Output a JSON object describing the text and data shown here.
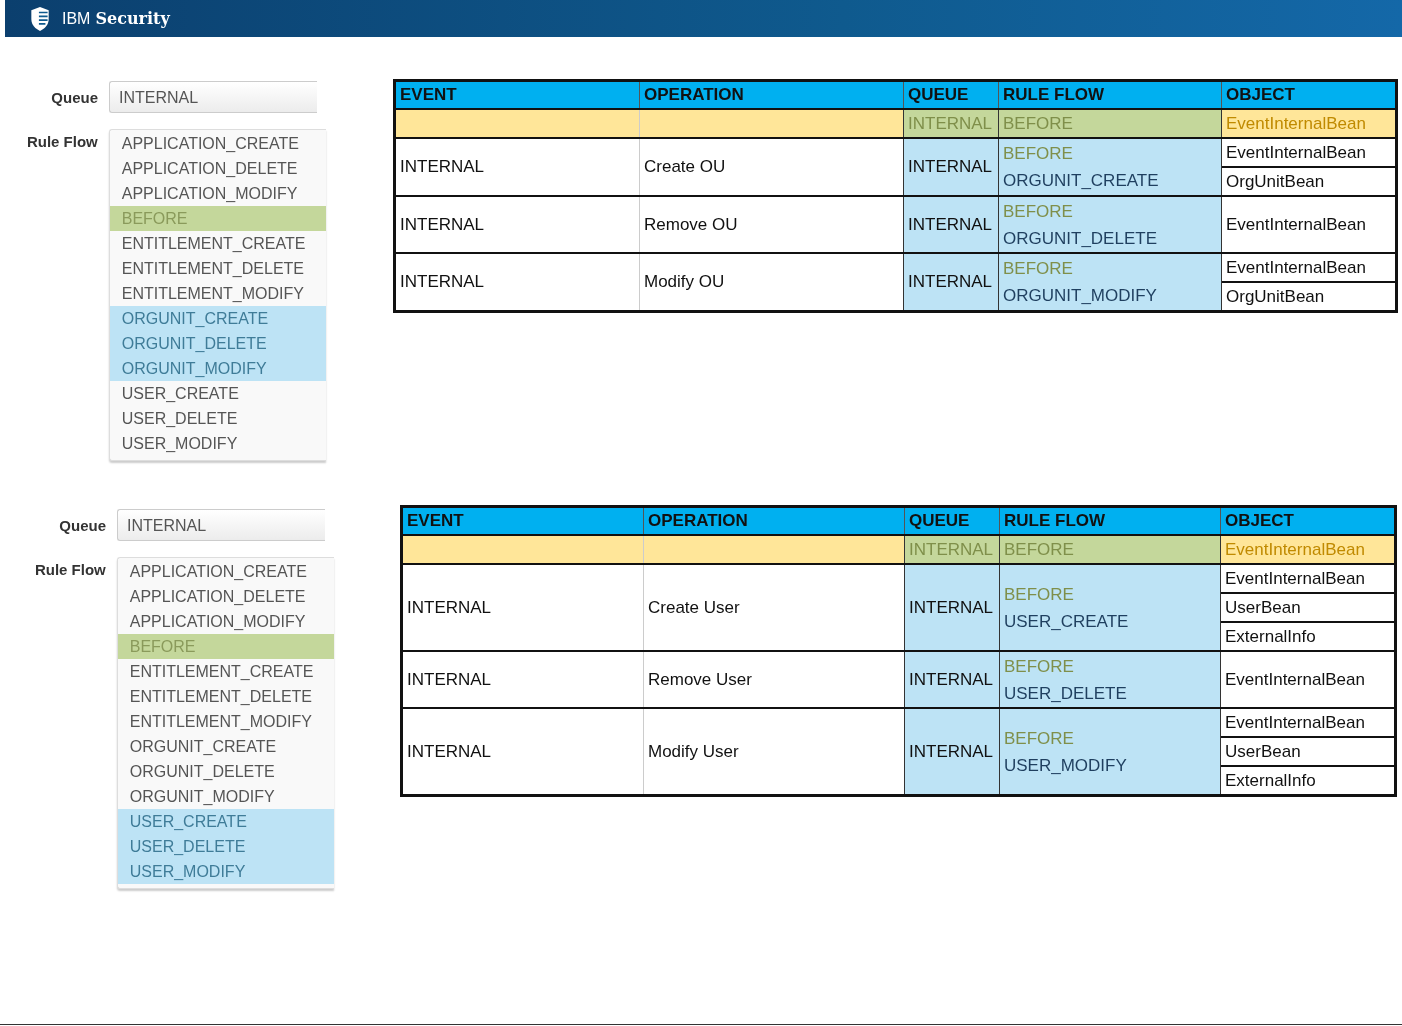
{
  "header": {
    "brand": "IBM",
    "product": "Security"
  },
  "sections": [
    {
      "form": {
        "queue_label": "Queue",
        "queue_value": "INTERNAL",
        "rule_flow_label": "Rule Flow",
        "rule_flow_items": [
          {
            "label": "APPLICATION_CREATE",
            "selected": false,
            "color": "#f9f9f9"
          },
          {
            "label": "APPLICATION_DELETE",
            "selected": false,
            "color": "#f9f9f9"
          },
          {
            "label": "APPLICATION_MODIFY",
            "selected": false,
            "color": "#f9f9f9"
          },
          {
            "label": "BEFORE",
            "selected": true,
            "color": "#c4d79b"
          },
          {
            "label": "ENTITLEMENT_CREATE",
            "selected": false,
            "color": "#f9f9f9"
          },
          {
            "label": "ENTITLEMENT_DELETE",
            "selected": false,
            "color": "#f9f9f9"
          },
          {
            "label": "ENTITLEMENT_MODIFY",
            "selected": false,
            "color": "#f9f9f9"
          },
          {
            "label": "ORGUNIT_CREATE",
            "selected": true,
            "color": "#bde3f5"
          },
          {
            "label": "ORGUNIT_DELETE",
            "selected": true,
            "color": "#bde3f5"
          },
          {
            "label": "ORGUNIT_MODIFY",
            "selected": true,
            "color": "#bde3f5"
          },
          {
            "label": "USER_CREATE",
            "selected": false,
            "color": "#f9f9f9"
          },
          {
            "label": "USER_DELETE",
            "selected": false,
            "color": "#f9f9f9"
          },
          {
            "label": "USER_MODIFY",
            "selected": false,
            "color": "#f9f9f9"
          }
        ]
      },
      "table": {
        "columns": [
          "EVENT",
          "OPERATION",
          "QUEUE",
          "RULE FLOW",
          "OBJECT"
        ],
        "rows": [
          {
            "kind": "template",
            "queue": "INTERNAL",
            "rule_flow": [
              {
                "text": "BEFORE",
                "kind": "before"
              }
            ],
            "objects": [
              "EventInternalBean"
            ]
          },
          {
            "kind": "entry",
            "event": "INTERNAL",
            "operation": "Create OU",
            "queue": "INTERNAL",
            "rule_flow": [
              {
                "text": "BEFORE",
                "kind": "before"
              },
              {
                "text": "ORGUNIT_CREATE",
                "kind": "event"
              }
            ],
            "objects": [
              "EventInternalBean",
              "OrgUnitBean"
            ]
          },
          {
            "kind": "entry",
            "event": "INTERNAL",
            "operation": "Remove OU",
            "queue": "INTERNAL",
            "rule_flow": [
              {
                "text": "BEFORE",
                "kind": "before"
              },
              {
                "text": "ORGUNIT_DELETE",
                "kind": "event"
              }
            ],
            "objects": [
              "EventInternalBean"
            ]
          },
          {
            "kind": "entry",
            "event": "INTERNAL",
            "operation": "Modify OU",
            "queue": "INTERNAL",
            "rule_flow": [
              {
                "text": "BEFORE",
                "kind": "before"
              },
              {
                "text": "ORGUNIT_MODIFY",
                "kind": "event"
              }
            ],
            "objects": [
              "EventInternalBean",
              "OrgUnitBean"
            ]
          }
        ]
      }
    },
    {
      "form": {
        "queue_label": "Queue",
        "queue_value": "INTERNAL",
        "rule_flow_label": "Rule Flow",
        "rule_flow_items": [
          {
            "label": "APPLICATION_CREATE",
            "selected": false,
            "color": "#f9f9f9"
          },
          {
            "label": "APPLICATION_DELETE",
            "selected": false,
            "color": "#f9f9f9"
          },
          {
            "label": "APPLICATION_MODIFY",
            "selected": false,
            "color": "#f9f9f9"
          },
          {
            "label": "BEFORE",
            "selected": true,
            "color": "#c4d79b"
          },
          {
            "label": "ENTITLEMENT_CREATE",
            "selected": false,
            "color": "#f9f9f9"
          },
          {
            "label": "ENTITLEMENT_DELETE",
            "selected": false,
            "color": "#f9f9f9"
          },
          {
            "label": "ENTITLEMENT_MODIFY",
            "selected": false,
            "color": "#f9f9f9"
          },
          {
            "label": "ORGUNIT_CREATE",
            "selected": false,
            "color": "#f9f9f9"
          },
          {
            "label": "ORGUNIT_DELETE",
            "selected": false,
            "color": "#f9f9f9"
          },
          {
            "label": "ORGUNIT_MODIFY",
            "selected": false,
            "color": "#f9f9f9"
          },
          {
            "label": "USER_CREATE",
            "selected": true,
            "color": "#bde3f5"
          },
          {
            "label": "USER_DELETE",
            "selected": true,
            "color": "#bde3f5"
          },
          {
            "label": "USER_MODIFY",
            "selected": true,
            "color": "#bde3f5"
          }
        ]
      },
      "table": {
        "columns": [
          "EVENT",
          "OPERATION",
          "QUEUE",
          "RULE FLOW",
          "OBJECT"
        ],
        "rows": [
          {
            "kind": "template",
            "queue": "INTERNAL",
            "rule_flow": [
              {
                "text": "BEFORE",
                "kind": "before"
              }
            ],
            "objects": [
              "EventInternalBean"
            ]
          },
          {
            "kind": "entry",
            "event": "INTERNAL",
            "operation": "Create User",
            "queue": "INTERNAL",
            "rule_flow": [
              {
                "text": "BEFORE",
                "kind": "before"
              },
              {
                "text": "USER_CREATE",
                "kind": "event"
              }
            ],
            "objects": [
              "EventInternalBean",
              "UserBean",
              "ExternalInfo"
            ]
          },
          {
            "kind": "entry",
            "event": "INTERNAL",
            "operation": "Remove User",
            "queue": "INTERNAL",
            "rule_flow": [
              {
                "text": "BEFORE",
                "kind": "before"
              },
              {
                "text": "USER_DELETE",
                "kind": "event"
              }
            ],
            "objects": [
              "EventInternalBean"
            ]
          },
          {
            "kind": "entry",
            "event": "INTERNAL",
            "operation": "Modify User",
            "queue": "INTERNAL",
            "rule_flow": [
              {
                "text": "BEFORE",
                "kind": "before"
              },
              {
                "text": "USER_MODIFY",
                "kind": "event"
              }
            ],
            "objects": [
              "EventInternalBean",
              "UserBean",
              "ExternalInfo"
            ]
          }
        ]
      }
    }
  ]
}
